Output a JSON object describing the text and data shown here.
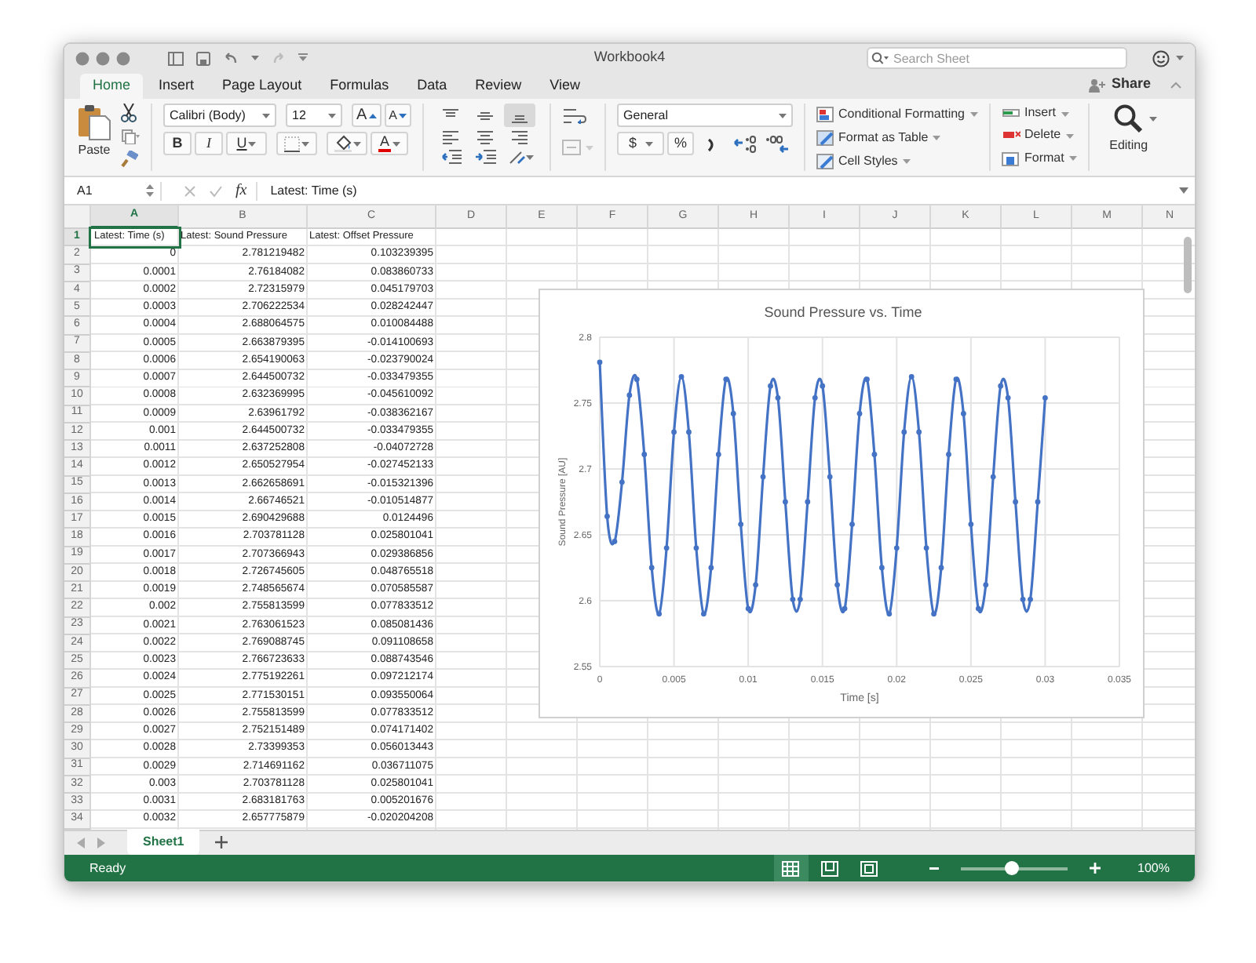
{
  "window": {
    "title": "Workbook4"
  },
  "search": {
    "placeholder": "Search Sheet"
  },
  "share": "Share",
  "tabs": [
    {
      "label": "Home",
      "selected": true
    },
    {
      "label": "Insert",
      "selected": false
    },
    {
      "label": "Page Layout",
      "selected": false
    },
    {
      "label": "Formulas",
      "selected": false
    },
    {
      "label": "Data",
      "selected": false
    },
    {
      "label": "Review",
      "selected": false
    },
    {
      "label": "View",
      "selected": false
    }
  ],
  "ribbon": {
    "paste": "Paste",
    "font": "Calibri (Body)",
    "font_size": "12",
    "grow_font": "A",
    "shrink_font": "A",
    "bold": "B",
    "italic": "I",
    "underline": "U",
    "font_color": "A",
    "vertical_alignment": [
      {
        "kind": "top",
        "selected": false
      },
      {
        "kind": "middle",
        "selected": false
      },
      {
        "kind": "bottom",
        "selected": true
      }
    ],
    "number_format": "General",
    "currency": "$",
    "percent": "%",
    "styles": [
      "Conditional Formatting",
      "Format as Table",
      "Cell Styles"
    ],
    "cells": [
      "Insert",
      "Delete",
      "Format"
    ],
    "editing": "Editing"
  },
  "formula_bar": {
    "name_box": "A1",
    "function_label": "fx",
    "formula": "Latest: Time (s)"
  },
  "sheet": {
    "columns": [
      {
        "label": "A",
        "selected": true
      },
      {
        "label": "B",
        "selected": false
      },
      {
        "label": "C",
        "selected": false
      },
      {
        "label": "D",
        "selected": false
      },
      {
        "label": "E",
        "selected": false
      },
      {
        "label": "F",
        "selected": false
      },
      {
        "label": "G",
        "selected": false
      },
      {
        "label": "H",
        "selected": false
      },
      {
        "label": "I",
        "selected": false
      },
      {
        "label": "J",
        "selected": false
      },
      {
        "label": "K",
        "selected": false
      },
      {
        "label": "L",
        "selected": false
      },
      {
        "label": "M",
        "selected": false
      },
      {
        "label": "N",
        "selected": false
      }
    ],
    "rows": [
      {
        "number": "1",
        "selected": true,
        "cells": [
          "Latest: Time (s)",
          "Latest: Sound Pressure",
          "Latest: Offset Pressure"
        ]
      },
      {
        "number": "2",
        "selected": false,
        "cells": [
          "0",
          "2.781219482",
          "0.103239395"
        ]
      },
      {
        "number": "3",
        "selected": false,
        "cells": [
          "0.0001",
          "2.76184082",
          "0.083860733"
        ]
      },
      {
        "number": "4",
        "selected": false,
        "cells": [
          "0.0002",
          "2.72315979",
          "0.045179703"
        ]
      },
      {
        "number": "5",
        "selected": false,
        "cells": [
          "0.0003",
          "2.706222534",
          "0.028242447"
        ]
      },
      {
        "number": "6",
        "selected": false,
        "cells": [
          "0.0004",
          "2.688064575",
          "0.010084488"
        ]
      },
      {
        "number": "7",
        "selected": false,
        "cells": [
          "0.0005",
          "2.663879395",
          "-0.014100693"
        ]
      },
      {
        "number": "8",
        "selected": false,
        "cells": [
          "0.0006",
          "2.654190063",
          "-0.023790024"
        ]
      },
      {
        "number": "9",
        "selected": false,
        "cells": [
          "0.0007",
          "2.644500732",
          "-0.033479355"
        ]
      },
      {
        "number": "10",
        "selected": false,
        "cells": [
          "0.0008",
          "2.632369995",
          "-0.045610092"
        ]
      },
      {
        "number": "11",
        "selected": false,
        "cells": [
          "0.0009",
          "2.63961792",
          "-0.038362167"
        ]
      },
      {
        "number": "12",
        "selected": false,
        "cells": [
          "0.001",
          "2.644500732",
          "-0.033479355"
        ]
      },
      {
        "number": "13",
        "selected": false,
        "cells": [
          "0.0011",
          "2.637252808",
          "-0.04072728"
        ]
      },
      {
        "number": "14",
        "selected": false,
        "cells": [
          "0.0012",
          "2.650527954",
          "-0.027452133"
        ]
      },
      {
        "number": "15",
        "selected": false,
        "cells": [
          "0.0013",
          "2.662658691",
          "-0.015321396"
        ]
      },
      {
        "number": "16",
        "selected": false,
        "cells": [
          "0.0014",
          "2.66746521",
          "-0.010514877"
        ]
      },
      {
        "number": "17",
        "selected": false,
        "cells": [
          "0.0015",
          "2.690429688",
          "0.0124496"
        ]
      },
      {
        "number": "18",
        "selected": false,
        "cells": [
          "0.0016",
          "2.703781128",
          "0.025801041"
        ]
      },
      {
        "number": "19",
        "selected": false,
        "cells": [
          "0.0017",
          "2.707366943",
          "0.029386856"
        ]
      },
      {
        "number": "20",
        "selected": false,
        "cells": [
          "0.0018",
          "2.726745605",
          "0.048765518"
        ]
      },
      {
        "number": "21",
        "selected": false,
        "cells": [
          "0.0019",
          "2.748565674",
          "0.070585587"
        ]
      },
      {
        "number": "22",
        "selected": false,
        "cells": [
          "0.002",
          "2.755813599",
          "0.077833512"
        ]
      },
      {
        "number": "23",
        "selected": false,
        "cells": [
          "0.0021",
          "2.763061523",
          "0.085081436"
        ]
      },
      {
        "number": "24",
        "selected": false,
        "cells": [
          "0.0022",
          "2.769088745",
          "0.091108658"
        ]
      },
      {
        "number": "25",
        "selected": false,
        "cells": [
          "0.0023",
          "2.766723633",
          "0.088743546"
        ]
      },
      {
        "number": "26",
        "selected": false,
        "cells": [
          "0.0024",
          "2.775192261",
          "0.097212174"
        ]
      },
      {
        "number": "27",
        "selected": false,
        "cells": [
          "0.0025",
          "2.771530151",
          "0.093550064"
        ]
      },
      {
        "number": "28",
        "selected": false,
        "cells": [
          "0.0026",
          "2.755813599",
          "0.077833512"
        ]
      },
      {
        "number": "29",
        "selected": false,
        "cells": [
          "0.0027",
          "2.752151489",
          "0.074171402"
        ]
      },
      {
        "number": "30",
        "selected": false,
        "cells": [
          "0.0028",
          "2.73399353",
          "0.056013443"
        ]
      },
      {
        "number": "31",
        "selected": false,
        "cells": [
          "0.0029",
          "2.714691162",
          "0.036711075"
        ]
      },
      {
        "number": "32",
        "selected": false,
        "cells": [
          "0.003",
          "2.703781128",
          "0.025801041"
        ]
      },
      {
        "number": "33",
        "selected": false,
        "cells": [
          "0.0031",
          "2.683181763",
          "0.005201676"
        ]
      },
      {
        "number": "34",
        "selected": false,
        "cells": [
          "0.0032",
          "2.657775879",
          "-0.020204208"
        ]
      }
    ]
  },
  "chart": {
    "chart_data": {
      "type": "line",
      "title": "Sound Pressure vs. Time",
      "xlabel": "Time [s]",
      "ylabel": "Sound Pressure [AU]",
      "x": [
        0,
        0.0005,
        0.001,
        0.0015,
        0.002,
        0.0025,
        0.003,
        0.0035,
        0.004,
        0.0045,
        0.005,
        0.0055,
        0.006,
        0.0065,
        0.007,
        0.0075,
        0.008,
        0.0085,
        0.009,
        0.0095,
        0.01,
        0.0105,
        0.011,
        0.0115,
        0.012,
        0.0125,
        0.013,
        0.0135,
        0.014,
        0.0145,
        0.015,
        0.0155,
        0.016,
        0.0165,
        0.017,
        0.0175,
        0.018,
        0.0185,
        0.019,
        0.0195,
        0.02,
        0.0205,
        0.021,
        0.0215,
        0.022,
        0.0225,
        0.023,
        0.0235,
        0.024,
        0.0245,
        0.025,
        0.0255,
        0.026,
        0.0265,
        0.027,
        0.0275,
        0.028,
        0.0285,
        0.029,
        0.0295,
        0.03
      ],
      "grid": true,
      "series": [
        {
          "color": "#4472c4",
          "marker": "circle",
          "values": [
            2.781,
            2.664,
            2.645,
            2.69,
            2.756,
            2.768,
            2.711,
            2.625,
            2.59,
            2.64,
            2.728,
            2.77,
            2.728,
            2.64,
            2.59,
            2.625,
            2.711,
            2.768,
            2.742,
            2.658,
            2.594,
            2.612,
            2.694,
            2.763,
            2.754,
            2.675,
            2.601,
            2.601,
            2.675,
            2.754,
            2.763,
            2.694,
            2.612,
            2.594,
            2.658,
            2.742,
            2.768,
            2.711,
            2.625,
            2.59,
            2.64,
            2.728,
            2.77,
            2.728,
            2.64,
            2.59,
            2.625,
            2.711,
            2.768,
            2.742,
            2.658,
            2.594,
            2.612,
            2.694,
            2.763,
            2.754,
            2.675,
            2.601,
            2.601,
            2.675,
            2.754
          ]
        }
      ],
      "xlim": [
        0,
        0.035
      ],
      "ylim": [
        2.55,
        2.8
      ],
      "xticks": [
        0,
        0.005,
        0.01,
        0.015,
        0.02,
        0.025,
        0.03,
        0.035
      ],
      "yticks": [
        2.55,
        2.6,
        2.65,
        2.7,
        2.75,
        2.8
      ]
    }
  },
  "sheet_tabs": [
    {
      "label": "Sheet1",
      "selected": true
    }
  ],
  "status_bar": {
    "status": "Ready",
    "views": [
      {
        "kind": "normal",
        "selected": true
      },
      {
        "kind": "page_layout",
        "selected": false
      },
      {
        "kind": "page_break",
        "selected": false
      }
    ],
    "zoom": {
      "level": 0.48
    },
    "zoom_text": "100%"
  }
}
